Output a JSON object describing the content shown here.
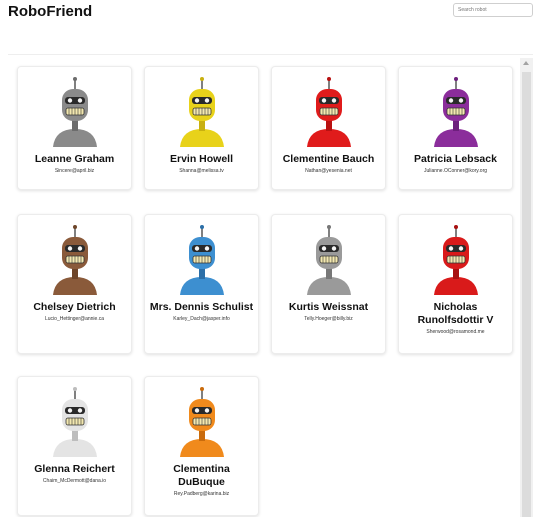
{
  "app": {
    "title": "RoboFriend",
    "search_placeholder": "Search robot"
  },
  "robots": [
    {
      "name": "Leanne Graham",
      "email": "Sincere@april.biz",
      "color": "#8a8a8a",
      "accent": "#6c6c6c"
    },
    {
      "name": "Ervin Howell",
      "email": "Shanna@melissa.tv",
      "color": "#e8d21a",
      "accent": "#c8b010"
    },
    {
      "name": "Clementine Bauch",
      "email": "Nathan@yesenia.net",
      "color": "#e01b1b",
      "accent": "#b81111"
    },
    {
      "name": "Patricia Lebsack",
      "email": "Julianne.OConner@kory.org",
      "color": "#8b2d9b",
      "accent": "#6d1f7d"
    },
    {
      "name": "Chelsey Dietrich",
      "email": "Lucio_Hettinger@annie.ca",
      "color": "#8a5a3a",
      "accent": "#6e4529"
    },
    {
      "name": "Mrs. Dennis Schulist",
      "email": "Karley_Dach@jasper.info",
      "color": "#3d8fd0",
      "accent": "#2b6fa8"
    },
    {
      "name": "Kurtis Weissnat",
      "email": "Telly.Hoeger@billy.biz",
      "color": "#9a9a9a",
      "accent": "#777777"
    },
    {
      "name": "Nicholas Runolfsdottir V",
      "email": "Sherwood@rosamond.me",
      "color": "#d91a1a",
      "accent": "#a81010"
    },
    {
      "name": "Glenna Reichert",
      "email": "Chaim_McDermott@dana.io",
      "color": "#e4e4e4",
      "accent": "#bdbdbd"
    },
    {
      "name": "Clementina DuBuque",
      "email": "Rey.Padberg@karina.biz",
      "color": "#f08a1c",
      "accent": "#c96b0c"
    }
  ]
}
